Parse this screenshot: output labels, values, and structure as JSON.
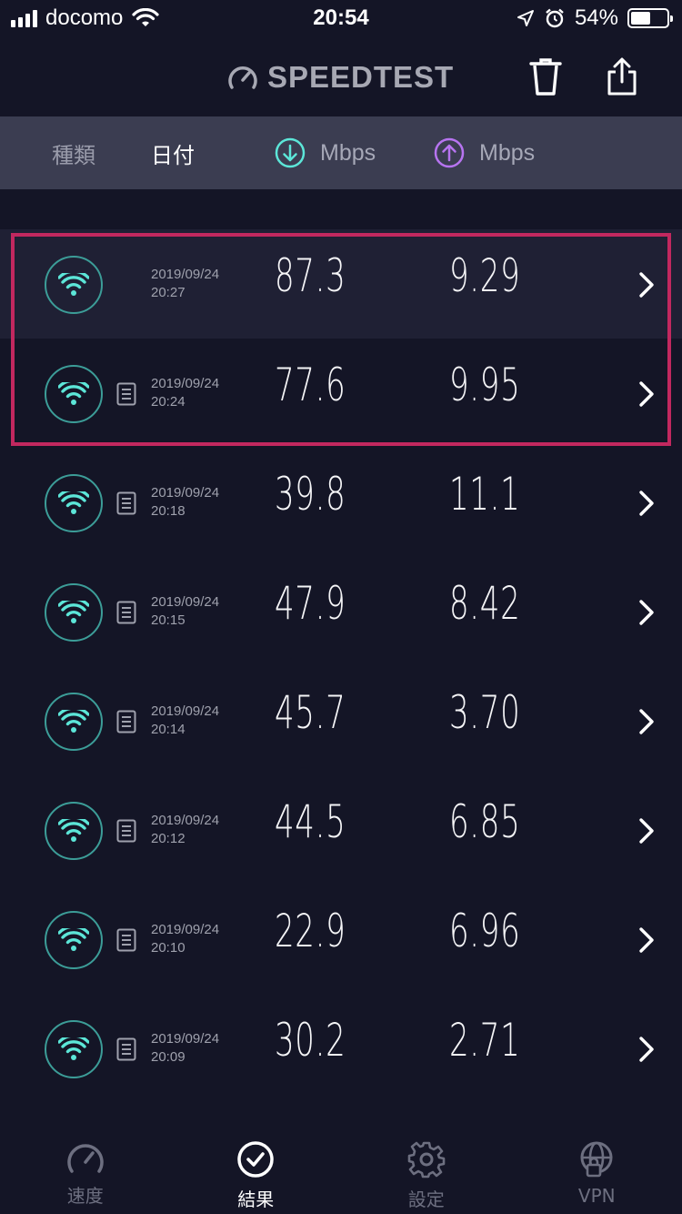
{
  "status_bar": {
    "carrier": "docomo",
    "time": "20:54",
    "battery": "54%",
    "battery_level": 0.54
  },
  "header": {
    "logo_text": "SPEEDTEST",
    "icons": [
      "speedometer-icon",
      "trash-icon",
      "share-icon"
    ]
  },
  "columns": {
    "type": "種類",
    "date": "日付",
    "download_unit": "Mbps",
    "upload_unit": "Mbps"
  },
  "colors": {
    "background": "#141526",
    "header_bar": "#3b3d51",
    "wifi_teal": "#5ce6d8",
    "download_accent": "#5ce6d8",
    "upload_accent": "#b774f0",
    "highlight": "#c2285f"
  },
  "results": [
    {
      "date": "2019/09/24",
      "time": "20:27",
      "download": "87.3",
      "upload": "9.29",
      "has_note": false
    },
    {
      "date": "2019/09/24",
      "time": "20:24",
      "download": "77.6",
      "upload": "9.95",
      "has_note": true
    },
    {
      "date": "2019/09/24",
      "time": "20:18",
      "download": "39.8",
      "upload": "11.1",
      "has_note": true
    },
    {
      "date": "2019/09/24",
      "time": "20:15",
      "download": "47.9",
      "upload": "8.42",
      "has_note": true
    },
    {
      "date": "2019/09/24",
      "time": "20:14",
      "download": "45.7",
      "upload": "3.70",
      "has_note": true
    },
    {
      "date": "2019/09/24",
      "time": "20:12",
      "download": "44.5",
      "upload": "6.85",
      "has_note": true
    },
    {
      "date": "2019/09/24",
      "time": "20:10",
      "download": "22.9",
      "upload": "6.96",
      "has_note": true
    },
    {
      "date": "2019/09/24",
      "time": "20:09",
      "download": "30.2",
      "upload": "2.71",
      "has_note": true
    }
  ],
  "tabs": [
    {
      "label": "速度",
      "icon": "speedometer-icon",
      "active": false
    },
    {
      "label": "結果",
      "icon": "checkmark-circle-icon",
      "active": true
    },
    {
      "label": "設定",
      "icon": "gear-icon",
      "active": false
    },
    {
      "label": "VPN",
      "icon": "globe-lock-icon",
      "active": false
    }
  ]
}
